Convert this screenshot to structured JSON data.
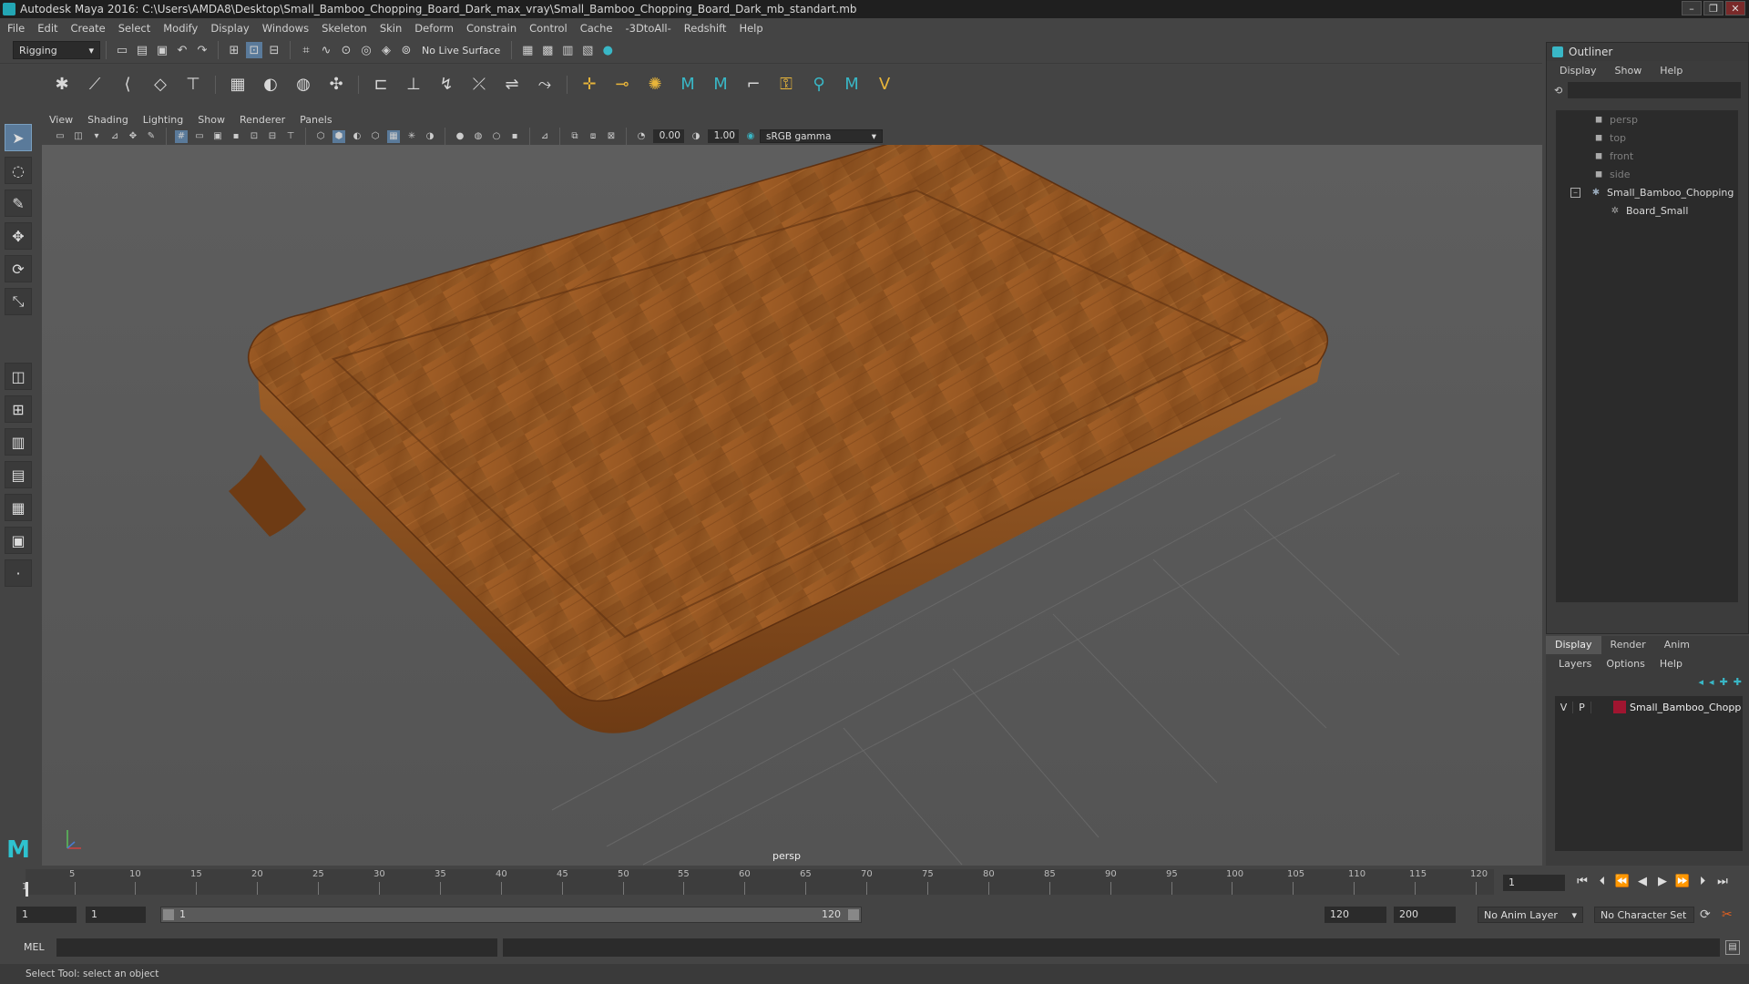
{
  "window": {
    "title": "Autodesk Maya 2016: C:\\Users\\AMDA8\\Desktop\\Small_Bamboo_Chopping_Board_Dark_max_vray\\Small_Bamboo_Chopping_Board_Dark_mb_standart.mb",
    "buttons": [
      "–",
      "❐",
      "✕"
    ]
  },
  "menubar": [
    "File",
    "Edit",
    "Create",
    "Select",
    "Modify",
    "Display",
    "Windows",
    "Skeleton",
    "Skin",
    "Deform",
    "Constrain",
    "Control",
    "Cache",
    "-3DtoAll-",
    "Redshift",
    "Help"
  ],
  "statusline": {
    "menuset": "Rigging",
    "live_surface": "No Live Surface"
  },
  "panel": {
    "menu": [
      "View",
      "Shading",
      "Lighting",
      "Show",
      "Renderer",
      "Panels"
    ],
    "exposure": "0.00",
    "gamma": "1.00",
    "colorspace": "sRGB gamma",
    "camera_label": "persp"
  },
  "outliner": {
    "title": "Outliner",
    "menu": [
      "Display",
      "Show",
      "Help"
    ],
    "items": [
      {
        "label": "persp",
        "icon": "camera-icon"
      },
      {
        "label": "top",
        "icon": "camera-icon"
      },
      {
        "label": "front",
        "icon": "camera-icon"
      },
      {
        "label": "side",
        "icon": "camera-icon"
      },
      {
        "label": "Small_Bamboo_Chopping",
        "icon": "group-icon"
      },
      {
        "label": "Board_Small",
        "icon": "mesh-icon"
      }
    ]
  },
  "layers": {
    "tabs": [
      "Display",
      "Render",
      "Anim"
    ],
    "menu": [
      "Layers",
      "Options",
      "Help"
    ],
    "row": {
      "v": "V",
      "p": "P",
      "name": "Small_Bamboo_Chopp",
      "color": "#a01530"
    }
  },
  "timeline": {
    "ticks": [
      "5",
      "10",
      "15",
      "20",
      "25",
      "30",
      "35",
      "40",
      "45",
      "50",
      "55",
      "60",
      "65",
      "70",
      "75",
      "80",
      "85",
      "90",
      "95",
      "100",
      "105",
      "110",
      "115",
      "120"
    ],
    "start_label": "1",
    "current_frame": "1"
  },
  "range": {
    "start": "1",
    "playback_start": "1",
    "slider_start": "1",
    "slider_end": "120",
    "playback_end": "120",
    "end": "200",
    "anim_layer": "No Anim Layer",
    "character_set": "No Character Set"
  },
  "mel": {
    "label": "MEL"
  },
  "helpline": "Select Tool: select an object",
  "colors": {
    "accent": "#39b7c6",
    "layer": "#a01530"
  }
}
